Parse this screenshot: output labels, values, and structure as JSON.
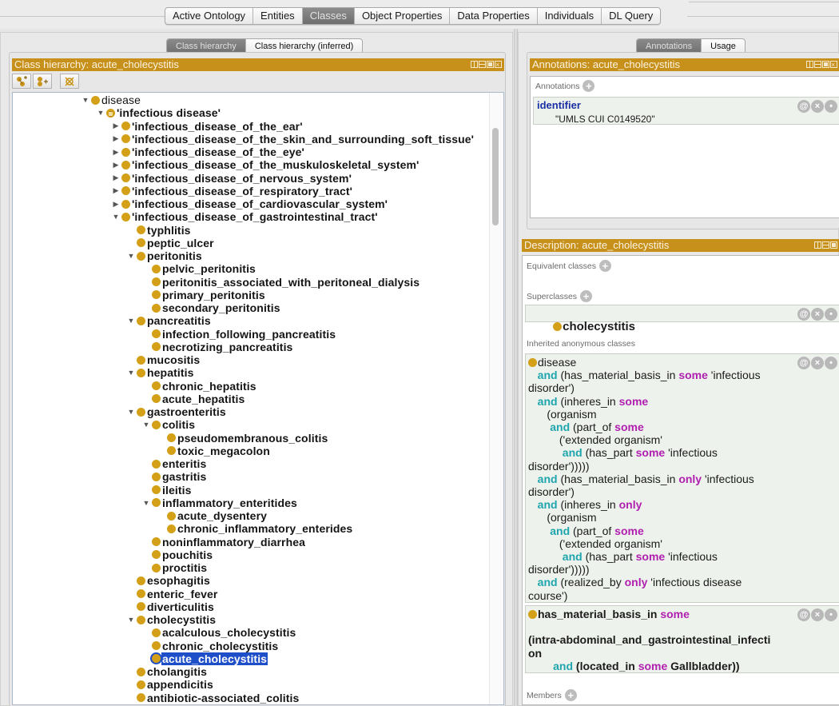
{
  "main_tabs": [
    {
      "label": "Active Ontology",
      "active": false
    },
    {
      "label": "Entities",
      "active": false
    },
    {
      "label": "Classes",
      "active": true
    },
    {
      "label": "Object Properties",
      "active": false
    },
    {
      "label": "Data Properties",
      "active": false
    },
    {
      "label": "Individuals",
      "active": false
    },
    {
      "label": "DL Query",
      "active": false
    }
  ],
  "left_pane": {
    "sub_tabs": [
      {
        "label": "Class hierarchy",
        "active": true
      },
      {
        "label": "Class hierarchy (inferred)",
        "active": false
      }
    ],
    "header": "Class hierarchy: acute_cholecystitis",
    "toolbar": [
      "add-subclass-icon",
      "add-sibling-class-icon",
      "delete-class-icon"
    ],
    "tree": [
      {
        "label": "disease",
        "level": 0,
        "twisty": "open",
        "bold": false
      },
      {
        "label": "'infectious disease'",
        "level": 1,
        "twisty": "open",
        "bold": true,
        "equivalent": true
      },
      {
        "label": "'infectious_disease_of_the_ear'",
        "level": 2,
        "twisty": "closed",
        "bold": true
      },
      {
        "label": "'infectious_disease_of_the_skin_and_surrounding_soft_tissue'",
        "level": 2,
        "twisty": "closed",
        "bold": true
      },
      {
        "label": "'infectious_disease_of_the_eye'",
        "level": 2,
        "twisty": "closed",
        "bold": true
      },
      {
        "label": "'infectious_disease_of_the_muskuloskeletal_system'",
        "level": 2,
        "twisty": "closed",
        "bold": true
      },
      {
        "label": "'infectious_disease_of_nervous_system'",
        "level": 2,
        "twisty": "closed",
        "bold": true
      },
      {
        "label": "'infectious_disease_of_respiratory_tract'",
        "level": 2,
        "twisty": "closed",
        "bold": true
      },
      {
        "label": "'infectious_disease_of_cardiovascular_system'",
        "level": 2,
        "twisty": "closed",
        "bold": true
      },
      {
        "label": "'infectious_disease_of_gastrointestinal_tract'",
        "level": 2,
        "twisty": "open",
        "bold": true
      },
      {
        "label": "typhlitis",
        "level": 3,
        "twisty": "none",
        "bold": true
      },
      {
        "label": "peptic_ulcer",
        "level": 3,
        "twisty": "none",
        "bold": true
      },
      {
        "label": "peritonitis",
        "level": 3,
        "twisty": "open",
        "bold": true
      },
      {
        "label": "pelvic_peritonitis",
        "level": 4,
        "twisty": "none",
        "bold": true
      },
      {
        "label": "peritonitis_associated_with_peritoneal_dialysis",
        "level": 4,
        "twisty": "none",
        "bold": true
      },
      {
        "label": "primary_peritonitis",
        "level": 4,
        "twisty": "none",
        "bold": true
      },
      {
        "label": "secondary_peritonitis",
        "level": 4,
        "twisty": "none",
        "bold": true
      },
      {
        "label": "pancreatitis",
        "level": 3,
        "twisty": "open",
        "bold": true
      },
      {
        "label": "infection_following_pancreatitis",
        "level": 4,
        "twisty": "none",
        "bold": true
      },
      {
        "label": "necrotizing_pancreatitis",
        "level": 4,
        "twisty": "none",
        "bold": true
      },
      {
        "label": "mucositis",
        "level": 3,
        "twisty": "none",
        "bold": true
      },
      {
        "label": "hepatitis",
        "level": 3,
        "twisty": "open",
        "bold": true
      },
      {
        "label": "chronic_hepatitis",
        "level": 4,
        "twisty": "none",
        "bold": true
      },
      {
        "label": "acute_hepatitis",
        "level": 4,
        "twisty": "none",
        "bold": true
      },
      {
        "label": "gastroenteritis",
        "level": 3,
        "twisty": "open",
        "bold": true
      },
      {
        "label": "colitis",
        "level": 4,
        "twisty": "open",
        "bold": true
      },
      {
        "label": "pseudomembranous_colitis",
        "level": 5,
        "twisty": "none",
        "bold": true
      },
      {
        "label": "toxic_megacolon",
        "level": 5,
        "twisty": "none",
        "bold": true
      },
      {
        "label": "enteritis",
        "level": 4,
        "twisty": "none",
        "bold": true
      },
      {
        "label": "gastritis",
        "level": 4,
        "twisty": "none",
        "bold": true
      },
      {
        "label": "ileitis",
        "level": 4,
        "twisty": "none",
        "bold": true
      },
      {
        "label": "inflammatory_enteritides",
        "level": 4,
        "twisty": "open",
        "bold": true
      },
      {
        "label": "acute_dysentery",
        "level": 5,
        "twisty": "none",
        "bold": true
      },
      {
        "label": "chronic_inflammatory_enterides",
        "level": 5,
        "twisty": "none",
        "bold": true
      },
      {
        "label": "noninflammatory_diarrhea",
        "level": 4,
        "twisty": "none",
        "bold": true
      },
      {
        "label": "pouchitis",
        "level": 4,
        "twisty": "none",
        "bold": true
      },
      {
        "label": "proctitis",
        "level": 4,
        "twisty": "none",
        "bold": true
      },
      {
        "label": "esophagitis",
        "level": 3,
        "twisty": "none",
        "bold": true
      },
      {
        "label": "enteric_fever",
        "level": 3,
        "twisty": "none",
        "bold": true
      },
      {
        "label": "diverticulitis",
        "level": 3,
        "twisty": "none",
        "bold": true
      },
      {
        "label": "cholecystitis",
        "level": 3,
        "twisty": "open",
        "bold": true
      },
      {
        "label": "acalculous_cholecystitis",
        "level": 4,
        "twisty": "none",
        "bold": true
      },
      {
        "label": "chronic_cholecystitis",
        "level": 4,
        "twisty": "none",
        "bold": true
      },
      {
        "label": "acute_cholecystitis",
        "level": 4,
        "twisty": "none",
        "bold": true,
        "selected": true
      },
      {
        "label": "cholangitis",
        "level": 3,
        "twisty": "none",
        "bold": true
      },
      {
        "label": "appendicitis",
        "level": 3,
        "twisty": "none",
        "bold": true
      },
      {
        "label": "antibiotic-associated_colitis",
        "level": 3,
        "twisty": "none",
        "bold": true
      }
    ]
  },
  "right_pane": {
    "sub_tabs": [
      {
        "label": "Annotations",
        "active": true
      },
      {
        "label": "Usage",
        "active": false
      }
    ],
    "annotations_view": {
      "header": "Annotations: acute_cholecystitis",
      "section_label": "Annotations",
      "items": [
        {
          "property": "identifier",
          "value": "\"UMLS CUI C0149520\""
        }
      ]
    },
    "description_view": {
      "header": "Description: acute_cholecystitis",
      "equivalent_label": "Equivalent classes",
      "superclasses_label": "Superclasses",
      "superclasses": [
        "cholecystitis"
      ],
      "inherited_label": "Inherited anonymous classes",
      "inherited": [
        [
          [
            [
              "t",
              "disease"
            ]
          ],
          [
            [
              "s",
              "   "
            ],
            [
              "and",
              "and"
            ],
            [
              "t",
              " (has_material_basis_in "
            ],
            [
              "q",
              "some"
            ],
            [
              "t",
              " 'infectious"
            ]
          ],
          [
            [
              "t",
              "disorder')"
            ]
          ],
          [
            [
              "s",
              "   "
            ],
            [
              "and",
              "and"
            ],
            [
              "t",
              " (inheres_in "
            ],
            [
              "q",
              "some"
            ]
          ],
          [
            [
              "t",
              "      (organism"
            ]
          ],
          [
            [
              "s",
              "       "
            ],
            [
              "and",
              "and"
            ],
            [
              "t",
              " (part_of "
            ],
            [
              "q",
              "some"
            ]
          ],
          [
            [
              "t",
              "          ('extended organism'"
            ]
          ],
          [
            [
              "s",
              "           "
            ],
            [
              "and",
              "and"
            ],
            [
              "t",
              " (has_part "
            ],
            [
              "q",
              "some"
            ],
            [
              "t",
              " 'infectious"
            ]
          ],
          [
            [
              "t",
              "disorder')))))"
            ]
          ],
          [
            [
              "s",
              "   "
            ],
            [
              "and",
              "and"
            ],
            [
              "t",
              " (has_material_basis_in "
            ],
            [
              "q",
              "only"
            ],
            [
              "t",
              " 'infectious"
            ]
          ],
          [
            [
              "t",
              "disorder')"
            ]
          ],
          [
            [
              "s",
              "   "
            ],
            [
              "and",
              "and"
            ],
            [
              "t",
              " (inheres_in "
            ],
            [
              "q",
              "only"
            ]
          ],
          [
            [
              "t",
              "      (organism"
            ]
          ],
          [
            [
              "s",
              "       "
            ],
            [
              "and",
              "and"
            ],
            [
              "t",
              " (part_of "
            ],
            [
              "q",
              "some"
            ]
          ],
          [
            [
              "t",
              "          ('extended organism'"
            ]
          ],
          [
            [
              "s",
              "           "
            ],
            [
              "and",
              "and"
            ],
            [
              "t",
              " (has_part "
            ],
            [
              "q",
              "some"
            ],
            [
              "t",
              " 'infectious"
            ]
          ],
          [
            [
              "t",
              "disorder')))))"
            ]
          ],
          [
            [
              "s",
              "   "
            ],
            [
              "and",
              "and"
            ],
            [
              "t",
              " (realized_by "
            ],
            [
              "q",
              "only"
            ],
            [
              "t",
              " 'infectious disease"
            ]
          ],
          [
            [
              "t",
              "course')"
            ]
          ]
        ],
        [
          [
            [
              "b",
              "has_material_basis_in "
            ],
            [
              "q",
              "some"
            ]
          ],
          [
            [
              "t",
              ""
            ]
          ],
          [
            [
              "b",
              "(intra-abdominal_and_gastrointestinal_infecti"
            ]
          ],
          [
            [
              "b",
              "on"
            ]
          ],
          [
            [
              "s",
              "        "
            ],
            [
              "and",
              "and"
            ],
            [
              "b",
              " (located_in "
            ],
            [
              "q",
              "some"
            ],
            [
              "b",
              " Gallbladder))"
            ]
          ]
        ]
      ],
      "members_label": "Members"
    }
  },
  "colors": {
    "header_bar": "#c7901b",
    "class_icon": "#d3a018",
    "selection": "#1e4fc9",
    "keyword_and": "#1ea5ad",
    "keyword_quantifier": "#b020b0",
    "annotation_property": "#1a2fa3"
  }
}
